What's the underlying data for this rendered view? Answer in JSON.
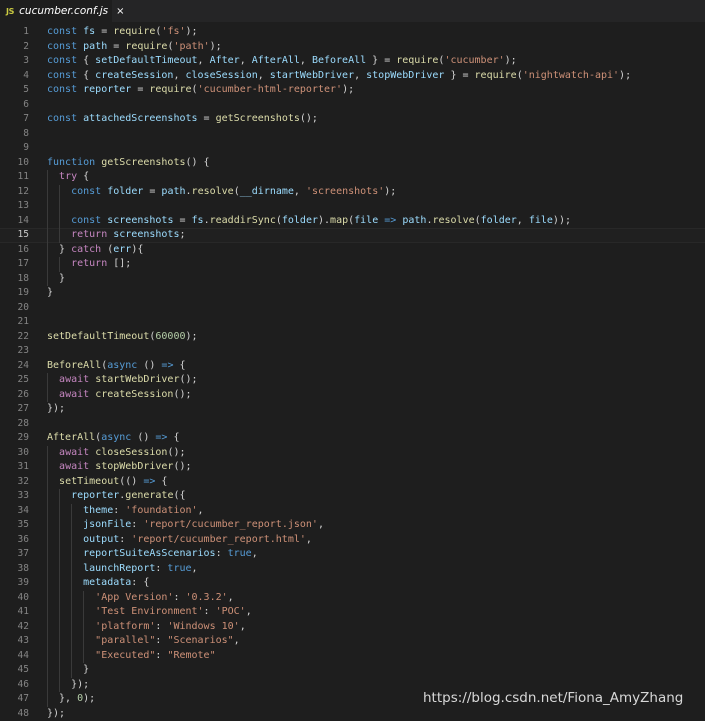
{
  "tab": {
    "icon": "JS",
    "label": "cucumber.conf.js",
    "close": "×"
  },
  "lines": [
    {
      "n": "1",
      "t": [
        [
          "k",
          "const"
        ],
        [
          "p",
          " "
        ],
        [
          "v",
          "fs"
        ],
        [
          "p",
          " = "
        ],
        [
          "f",
          "require"
        ],
        [
          "p",
          "("
        ],
        [
          "s",
          "'fs'"
        ],
        [
          "p",
          ");"
        ]
      ]
    },
    {
      "n": "2",
      "t": [
        [
          "k",
          "const"
        ],
        [
          "p",
          " "
        ],
        [
          "v",
          "path"
        ],
        [
          "p",
          " = "
        ],
        [
          "f",
          "require"
        ],
        [
          "p",
          "("
        ],
        [
          "s",
          "'path'"
        ],
        [
          "p",
          ");"
        ]
      ]
    },
    {
      "n": "3",
      "t": [
        [
          "k",
          "const"
        ],
        [
          "p",
          " { "
        ],
        [
          "v",
          "setDefaultTimeout"
        ],
        [
          "p",
          ", "
        ],
        [
          "v",
          "After"
        ],
        [
          "p",
          ", "
        ],
        [
          "v",
          "AfterAll"
        ],
        [
          "p",
          ", "
        ],
        [
          "v",
          "BeforeAll"
        ],
        [
          "p",
          " } = "
        ],
        [
          "f",
          "require"
        ],
        [
          "p",
          "("
        ],
        [
          "s",
          "'cucumber'"
        ],
        [
          "p",
          ");"
        ]
      ]
    },
    {
      "n": "4",
      "t": [
        [
          "k",
          "const"
        ],
        [
          "p",
          " { "
        ],
        [
          "v",
          "createSession"
        ],
        [
          "p",
          ", "
        ],
        [
          "v",
          "closeSession"
        ],
        [
          "p",
          ", "
        ],
        [
          "v",
          "startWebDriver"
        ],
        [
          "p",
          ", "
        ],
        [
          "v",
          "stopWebDriver"
        ],
        [
          "p",
          " } = "
        ],
        [
          "f",
          "require"
        ],
        [
          "p",
          "("
        ],
        [
          "s",
          "'nightwatch-api'"
        ],
        [
          "p",
          ");"
        ]
      ]
    },
    {
      "n": "5",
      "t": [
        [
          "k",
          "const"
        ],
        [
          "p",
          " "
        ],
        [
          "v",
          "reporter"
        ],
        [
          "p",
          " = "
        ],
        [
          "f",
          "require"
        ],
        [
          "p",
          "("
        ],
        [
          "s",
          "'cucumber-html-reporter'"
        ],
        [
          "p",
          ");"
        ]
      ]
    },
    {
      "n": "6",
      "t": []
    },
    {
      "n": "7",
      "t": [
        [
          "k",
          "const"
        ],
        [
          "p",
          " "
        ],
        [
          "v",
          "attachedScreenshots"
        ],
        [
          "p",
          " = "
        ],
        [
          "f",
          "getScreenshots"
        ],
        [
          "p",
          "();"
        ]
      ]
    },
    {
      "n": "8",
      "t": []
    },
    {
      "n": "9",
      "t": []
    },
    {
      "n": "10",
      "t": [
        [
          "k",
          "function"
        ],
        [
          "p",
          " "
        ],
        [
          "f",
          "getScreenshots"
        ],
        [
          "p",
          "() {"
        ]
      ]
    },
    {
      "n": "11",
      "t": [
        [
          "p",
          "  "
        ],
        [
          "c",
          "try"
        ],
        [
          "p",
          " {"
        ]
      ]
    },
    {
      "n": "12",
      "t": [
        [
          "p",
          "    "
        ],
        [
          "k",
          "const"
        ],
        [
          "p",
          " "
        ],
        [
          "v",
          "folder"
        ],
        [
          "p",
          " = "
        ],
        [
          "v",
          "path"
        ],
        [
          "p",
          "."
        ],
        [
          "f",
          "resolve"
        ],
        [
          "p",
          "("
        ],
        [
          "v",
          "__dirname"
        ],
        [
          "p",
          ", "
        ],
        [
          "s",
          "'screenshots'"
        ],
        [
          "p",
          ");"
        ]
      ]
    },
    {
      "n": "13",
      "t": []
    },
    {
      "n": "14",
      "t": [
        [
          "p",
          "    "
        ],
        [
          "k",
          "const"
        ],
        [
          "p",
          " "
        ],
        [
          "v",
          "screenshots"
        ],
        [
          "p",
          " = "
        ],
        [
          "v",
          "fs"
        ],
        [
          "p",
          "."
        ],
        [
          "f",
          "readdirSync"
        ],
        [
          "p",
          "("
        ],
        [
          "v",
          "folder"
        ],
        [
          "p",
          ")."
        ],
        [
          "f",
          "map"
        ],
        [
          "p",
          "("
        ],
        [
          "v",
          "file"
        ],
        [
          "p",
          " "
        ],
        [
          "k",
          "=>"
        ],
        [
          "p",
          " "
        ],
        [
          "v",
          "path"
        ],
        [
          "p",
          "."
        ],
        [
          "f",
          "resolve"
        ],
        [
          "p",
          "("
        ],
        [
          "v",
          "folder"
        ],
        [
          "p",
          ", "
        ],
        [
          "v",
          "file"
        ],
        [
          "p",
          "));"
        ]
      ]
    },
    {
      "n": "15",
      "t": [
        [
          "p",
          "    "
        ],
        [
          "c",
          "return"
        ],
        [
          "p",
          " "
        ],
        [
          "v",
          "screenshots"
        ],
        [
          "p",
          ";"
        ]
      ]
    },
    {
      "n": "16",
      "t": [
        [
          "p",
          "  } "
        ],
        [
          "c",
          "catch"
        ],
        [
          "p",
          " ("
        ],
        [
          "v",
          "err"
        ],
        [
          "p",
          "){"
        ]
      ]
    },
    {
      "n": "17",
      "t": [
        [
          "p",
          "    "
        ],
        [
          "c",
          "return"
        ],
        [
          "p",
          " [];"
        ]
      ]
    },
    {
      "n": "18",
      "t": [
        [
          "p",
          "  }"
        ]
      ]
    },
    {
      "n": "19",
      "t": [
        [
          "p",
          "}"
        ]
      ]
    },
    {
      "n": "20",
      "t": []
    },
    {
      "n": "21",
      "t": []
    },
    {
      "n": "22",
      "t": [
        [
          "f",
          "setDefaultTimeout"
        ],
        [
          "p",
          "("
        ],
        [
          "n",
          "60000"
        ],
        [
          "p",
          ");"
        ]
      ]
    },
    {
      "n": "23",
      "t": []
    },
    {
      "n": "24",
      "t": [
        [
          "f",
          "BeforeAll"
        ],
        [
          "p",
          "("
        ],
        [
          "k",
          "async"
        ],
        [
          "p",
          " () "
        ],
        [
          "k",
          "=>"
        ],
        [
          "p",
          " {"
        ]
      ]
    },
    {
      "n": "25",
      "t": [
        [
          "p",
          "  "
        ],
        [
          "c",
          "await"
        ],
        [
          "p",
          " "
        ],
        [
          "f",
          "startWebDriver"
        ],
        [
          "p",
          "();"
        ]
      ]
    },
    {
      "n": "26",
      "t": [
        [
          "p",
          "  "
        ],
        [
          "c",
          "await"
        ],
        [
          "p",
          " "
        ],
        [
          "f",
          "createSession"
        ],
        [
          "p",
          "();"
        ]
      ]
    },
    {
      "n": "27",
      "t": [
        [
          "p",
          "});"
        ]
      ]
    },
    {
      "n": "28",
      "t": []
    },
    {
      "n": "29",
      "t": [
        [
          "f",
          "AfterAll"
        ],
        [
          "p",
          "("
        ],
        [
          "k",
          "async"
        ],
        [
          "p",
          " () "
        ],
        [
          "k",
          "=>"
        ],
        [
          "p",
          " {"
        ]
      ]
    },
    {
      "n": "30",
      "t": [
        [
          "p",
          "  "
        ],
        [
          "c",
          "await"
        ],
        [
          "p",
          " "
        ],
        [
          "f",
          "closeSession"
        ],
        [
          "p",
          "();"
        ]
      ]
    },
    {
      "n": "31",
      "t": [
        [
          "p",
          "  "
        ],
        [
          "c",
          "await"
        ],
        [
          "p",
          " "
        ],
        [
          "f",
          "stopWebDriver"
        ],
        [
          "p",
          "();"
        ]
      ]
    },
    {
      "n": "32",
      "t": [
        [
          "p",
          "  "
        ],
        [
          "f",
          "setTimeout"
        ],
        [
          "p",
          "(() "
        ],
        [
          "k",
          "=>"
        ],
        [
          "p",
          " {"
        ]
      ]
    },
    {
      "n": "33",
      "t": [
        [
          "p",
          "    "
        ],
        [
          "v",
          "reporter"
        ],
        [
          "p",
          "."
        ],
        [
          "f",
          "generate"
        ],
        [
          "p",
          "({"
        ]
      ]
    },
    {
      "n": "34",
      "t": [
        [
          "p",
          "      "
        ],
        [
          "v",
          "theme"
        ],
        [
          "p",
          ": "
        ],
        [
          "s",
          "'foundation'"
        ],
        [
          "p",
          ","
        ]
      ]
    },
    {
      "n": "35",
      "t": [
        [
          "p",
          "      "
        ],
        [
          "v",
          "jsonFile"
        ],
        [
          "p",
          ": "
        ],
        [
          "s",
          "'report/cucumber_report.json'"
        ],
        [
          "p",
          ","
        ]
      ]
    },
    {
      "n": "36",
      "t": [
        [
          "p",
          "      "
        ],
        [
          "v",
          "output"
        ],
        [
          "p",
          ": "
        ],
        [
          "s",
          "'report/cucumber_report.html'"
        ],
        [
          "p",
          ","
        ]
      ]
    },
    {
      "n": "37",
      "t": [
        [
          "p",
          "      "
        ],
        [
          "v",
          "reportSuiteAsScenarios"
        ],
        [
          "p",
          ": "
        ],
        [
          "k",
          "true"
        ],
        [
          "p",
          ","
        ]
      ]
    },
    {
      "n": "38",
      "t": [
        [
          "p",
          "      "
        ],
        [
          "v",
          "launchReport"
        ],
        [
          "p",
          ": "
        ],
        [
          "k",
          "true"
        ],
        [
          "p",
          ","
        ]
      ]
    },
    {
      "n": "39",
      "t": [
        [
          "p",
          "      "
        ],
        [
          "v",
          "metadata"
        ],
        [
          "p",
          ": {"
        ]
      ]
    },
    {
      "n": "40",
      "t": [
        [
          "p",
          "        "
        ],
        [
          "s",
          "'App Version'"
        ],
        [
          "p",
          ": "
        ],
        [
          "s",
          "'0.3.2'"
        ],
        [
          "p",
          ","
        ]
      ]
    },
    {
      "n": "41",
      "t": [
        [
          "p",
          "        "
        ],
        [
          "s",
          "'Test Environment'"
        ],
        [
          "p",
          ": "
        ],
        [
          "s",
          "'POC'"
        ],
        [
          "p",
          ","
        ]
      ]
    },
    {
      "n": "42",
      "t": [
        [
          "p",
          "        "
        ],
        [
          "s",
          "'platform'"
        ],
        [
          "p",
          ": "
        ],
        [
          "s",
          "'Windows 10'"
        ],
        [
          "p",
          ","
        ]
      ]
    },
    {
      "n": "43",
      "t": [
        [
          "p",
          "        "
        ],
        [
          "s",
          "\"parallel\""
        ],
        [
          "p",
          ": "
        ],
        [
          "s",
          "\"Scenarios\""
        ],
        [
          "p",
          ","
        ]
      ]
    },
    {
      "n": "44",
      "t": [
        [
          "p",
          "        "
        ],
        [
          "s",
          "\"Executed\""
        ],
        [
          "p",
          ": "
        ],
        [
          "s",
          "\"Remote\""
        ]
      ]
    },
    {
      "n": "45",
      "t": [
        [
          "p",
          "      }"
        ]
      ]
    },
    {
      "n": "46",
      "t": [
        [
          "p",
          "    });"
        ]
      ]
    },
    {
      "n": "47",
      "t": [
        [
          "p",
          "  }, "
        ],
        [
          "n",
          "0"
        ],
        [
          "p",
          ");"
        ]
      ]
    },
    {
      "n": "48",
      "t": [
        [
          "p",
          "});"
        ]
      ]
    }
  ],
  "current_line": "15",
  "watermark": "https://blog.csdn.net/Fiona_AmyZhang",
  "colors": {
    "background": "#1e1e1e",
    "keyword": "#569cd6",
    "control": "#c586c0",
    "variable": "#9cdcfe",
    "function": "#dcdcaa",
    "string": "#ce9178",
    "number": "#b5cea8",
    "punctuation": "#d4d4d4",
    "line_number": "#858585"
  }
}
